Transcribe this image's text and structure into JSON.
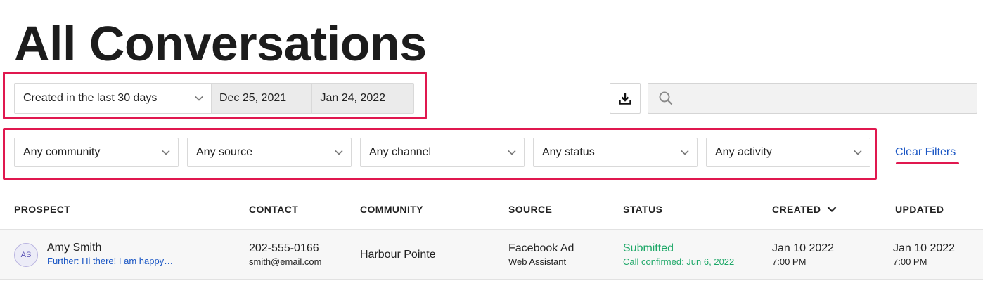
{
  "page": {
    "title": "All Conversations"
  },
  "date_filter": {
    "range_label": "Created in the last 30 days",
    "start_date": "Dec 25, 2021",
    "end_date": "Jan 24, 2022"
  },
  "search": {
    "placeholder": ""
  },
  "filters": [
    {
      "label": "Any community"
    },
    {
      "label": "Any source"
    },
    {
      "label": "Any channel"
    },
    {
      "label": "Any status"
    },
    {
      "label": "Any activity"
    }
  ],
  "clear_filters_label": "Clear Filters",
  "table": {
    "columns": {
      "prospect": "PROSPECT",
      "contact": "CONTACT",
      "community": "COMMUNITY",
      "source": "SOURCE",
      "status": "STATUS",
      "created": "CREATED",
      "updated": "UPDATED"
    },
    "rows": [
      {
        "initials": "AS",
        "name": "Amy Smith",
        "preview": "Further: Hi there! I am happy…",
        "phone": "202-555-0166",
        "email": "smith@email.com",
        "community": "Harbour Pointe",
        "source": "Facebook Ad",
        "source_sub": "Web Assistant",
        "status": "Submitted",
        "status_sub": "Call confirmed: Jun 6, 2022",
        "created_date": "Jan 10 2022",
        "created_time": "7:00 PM",
        "updated_date": "Jan 10 2022",
        "updated_time": "7:00 PM"
      }
    ]
  },
  "colors": {
    "highlight": "#e0184f",
    "link": "#1a56c4",
    "status_green": "#1ea868"
  },
  "icons": {
    "download": "download-icon",
    "search": "search-icon",
    "dropdown": "chevron-down-icon",
    "sort": "sort-descending-icon"
  }
}
